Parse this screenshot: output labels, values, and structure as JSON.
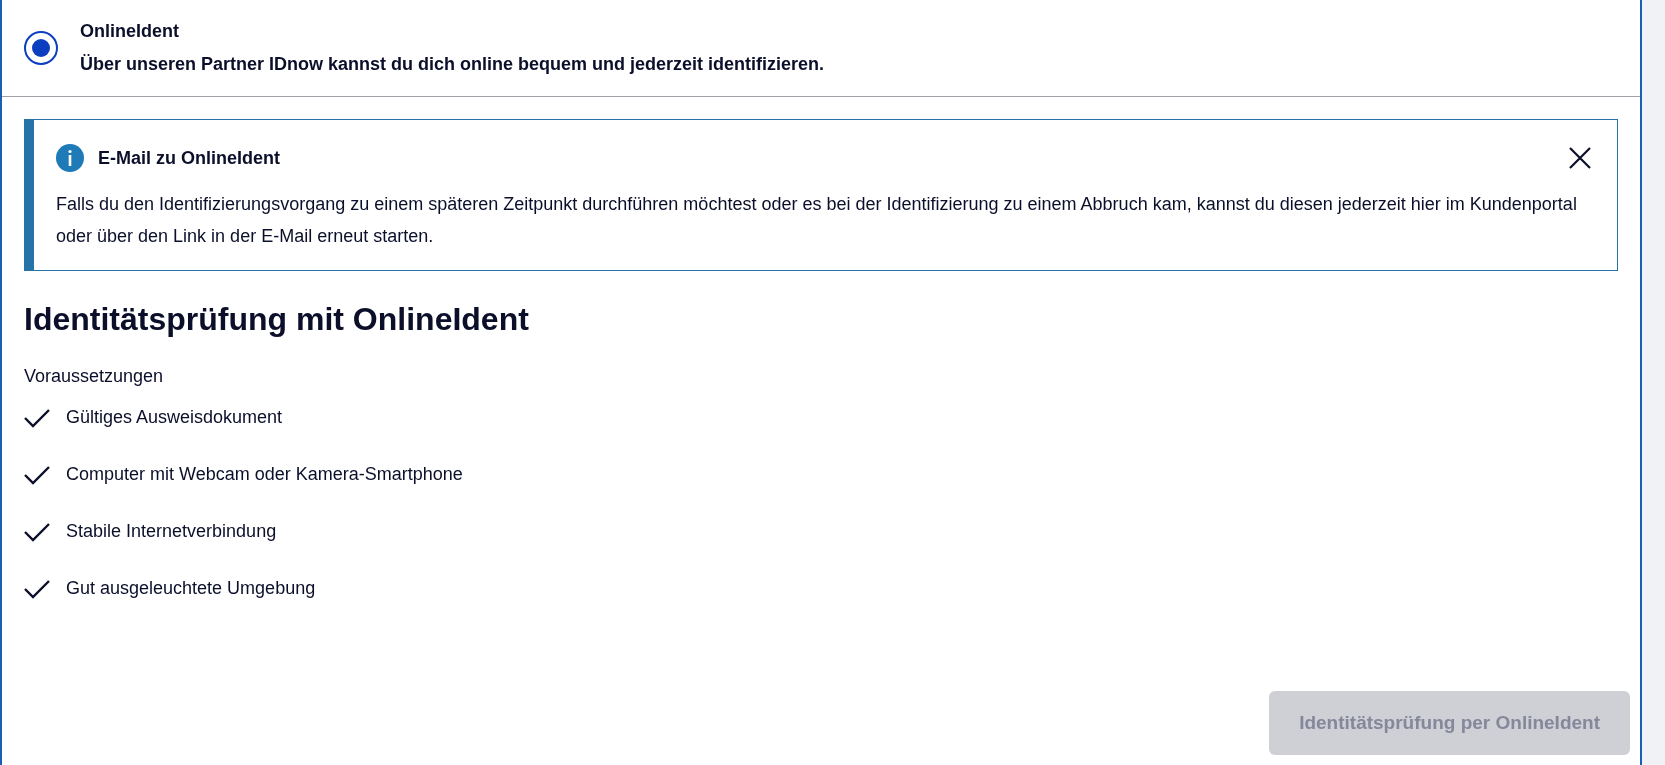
{
  "option": {
    "title": "OnlineIdent",
    "description": "Über unseren Partner IDnow kannst du dich online bequem und jederzeit identifizieren.",
    "selected": true
  },
  "info_box": {
    "title": "E-Mail zu OnlineIdent",
    "text": "Falls du den Identifizierungsvorgang zu einem späteren Zeitpunkt durchführen möchtest oder es bei der Identifizierung zu einem Abbruch kam, kannst du diesen jederzeit hier im Kundenportal oder über den Link in der E-Mail erneut starten."
  },
  "heading": "Identitätsprüfung mit OnlineIdent",
  "requirements": {
    "label": "Voraussetzungen",
    "items": [
      {
        "text": "Gültiges Ausweisdokument"
      },
      {
        "text": "Computer mit Webcam oder Kamera-Smartphone"
      },
      {
        "text": "Stabile Internetverbindung"
      },
      {
        "text": "Gut ausgeleuchtete Umgebung"
      }
    ]
  },
  "submit_button": {
    "label": "Identitätsprüfung per OnlineIdent",
    "disabled": true
  }
}
